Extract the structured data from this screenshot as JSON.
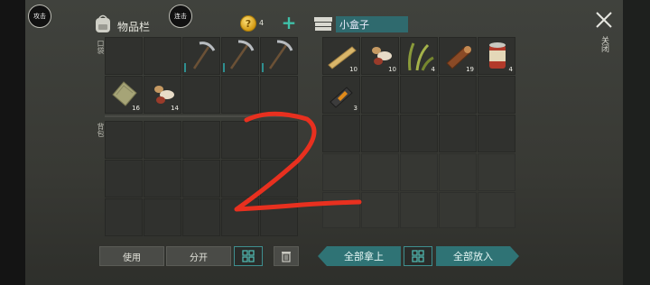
{
  "top_buttons": {
    "attack": "攻击",
    "combo": "连击"
  },
  "inventory": {
    "title": "物品栏",
    "pocket_label": "口袋",
    "backpack_label": "背包"
  },
  "currency": {
    "amount": "4"
  },
  "container": {
    "title": "小盒子"
  },
  "close": {
    "label": "关闭"
  },
  "pocket_slots": [
    {
      "item": "",
      "qty": ""
    },
    {
      "item": "",
      "qty": ""
    },
    {
      "item": "pickaxe-icon",
      "qty": ""
    },
    {
      "item": "pickaxe-icon",
      "qty": ""
    },
    {
      "item": "pickaxe-icon",
      "qty": ""
    },
    {
      "item": "cloth-icon",
      "qty": "16"
    },
    {
      "item": "seeds-icon",
      "qty": "14"
    },
    {
      "item": "",
      "qty": ""
    },
    {
      "item": "",
      "qty": ""
    },
    {
      "item": "",
      "qty": ""
    }
  ],
  "box_slots": [
    {
      "item": "plank-icon",
      "qty": "10"
    },
    {
      "item": "seeds-icon",
      "qty": "10"
    },
    {
      "item": "grass-icon",
      "qty": "4"
    },
    {
      "item": "log-icon",
      "qty": "19"
    },
    {
      "item": "can-icon",
      "qty": "4"
    },
    {
      "item": "battery-icon",
      "qty": "3"
    }
  ],
  "buttons": {
    "use": "使用",
    "split": "分开",
    "take_all": "全部拿上",
    "put_all": "全部放入"
  },
  "colors": {
    "accent": "#2f6f72",
    "annotation": "#e8301f"
  }
}
